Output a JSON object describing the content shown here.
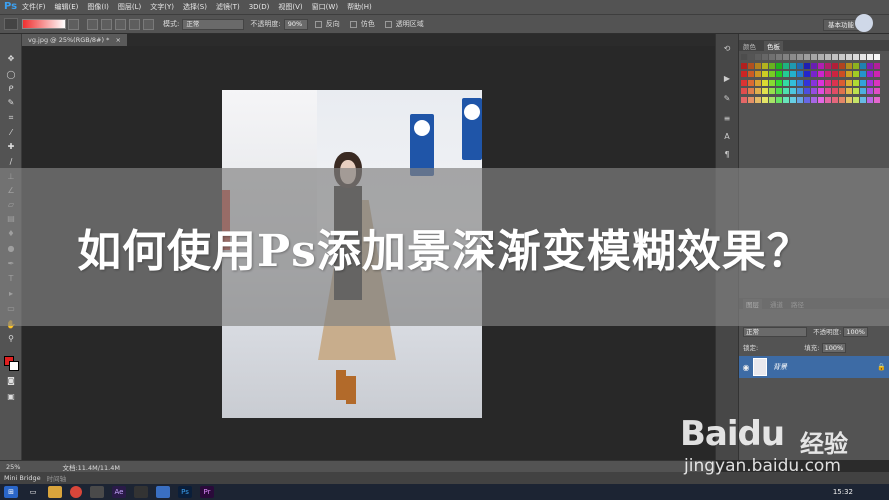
{
  "app": {
    "logo": "Ps"
  },
  "menu": [
    "文件(F)",
    "编辑(E)",
    "图像(I)",
    "图层(L)",
    "文字(Y)",
    "选择(S)",
    "滤镜(T)",
    "3D(D)",
    "视图(V)",
    "窗口(W)",
    "帮助(H)"
  ],
  "options": {
    "mode_label": "模式:",
    "mode_value": "正常",
    "opacity_label": "不透明度:",
    "opacity_value": "90%",
    "reverse_label": "反向",
    "dither_label": "仿色",
    "transparency_label": "透明区域",
    "workspace": "基本功能"
  },
  "document": {
    "tab": "vg.jpg @ 25%(RGB/8#) *",
    "close": "×"
  },
  "banner": {
    "title": "如何使用Ps添加景深渐变模糊效果？"
  },
  "panels": {
    "color_tab": "颜色",
    "swatch_tab": "色板",
    "layers_tab": "图层",
    "channels_tab": "通道",
    "paths_tab": "路径",
    "blend_mode": "正常",
    "opacity_label": "不透明度:",
    "opacity_value": "100%",
    "lock_label": "锁定:",
    "fill_label": "填充:",
    "fill_value": "100%",
    "layer_name": "背景"
  },
  "status": {
    "zoom": "25%",
    "doc_info": "文档:11.4M/11.4M"
  },
  "bridge": {
    "tab1": "Mini Bridge",
    "tab2": "时间轴"
  },
  "taskbar": {
    "time": "15:32"
  },
  "watermark": {
    "brand": "Baidu",
    "cn": "经验",
    "url": "jingyan.baidu.com"
  },
  "colors": {
    "ui": "#535353",
    "canvas": "#282828",
    "layer_selected": "#3d6ba5",
    "foreground": "#e02020",
    "background": "#ffffff"
  }
}
